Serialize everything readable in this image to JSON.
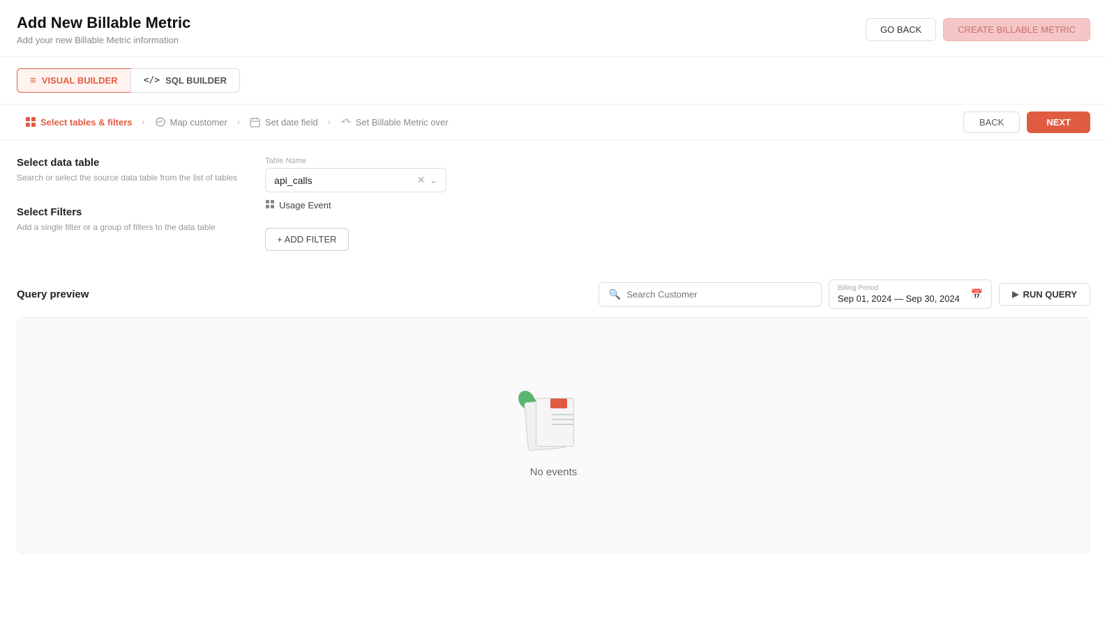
{
  "page": {
    "title": "Add New Billable Metric",
    "subtitle": "Add your new Billable Metric information"
  },
  "header_actions": {
    "go_back_label": "GO BACK",
    "create_label": "CREATE BILLABLE METRIC"
  },
  "builder_tabs": [
    {
      "id": "visual",
      "label": "VISUAL BUILDER",
      "active": true
    },
    {
      "id": "sql",
      "label": "SQL BUILDER",
      "active": false
    }
  ],
  "steps": [
    {
      "id": "tables",
      "label": "Select tables & filters",
      "active": true,
      "icon": "grid-icon"
    },
    {
      "id": "customer",
      "label": "Map customer",
      "active": false,
      "icon": "map-icon"
    },
    {
      "id": "date",
      "label": "Set date field",
      "active": false,
      "icon": "calendar-icon"
    },
    {
      "id": "metric",
      "label": "Set Billable Metric over",
      "active": false,
      "icon": "metric-icon"
    }
  ],
  "steps_nav": {
    "back_label": "BACK",
    "next_label": "NEXT"
  },
  "select_data_table": {
    "title": "Select data table",
    "description": "Search or select the source data table from the list of tables",
    "field_label": "Table Name",
    "selected_value": "api_calls",
    "badge_label": "Usage Event"
  },
  "select_filters": {
    "title": "Select Filters",
    "description": "Add a single filter or a group of filters to the data table",
    "add_button_label": "+ ADD FILTER"
  },
  "query_preview": {
    "title": "Query preview",
    "search_placeholder": "Search Customer",
    "billing_period_label": "Billing Period",
    "billing_period_value": "Sep 01, 2024 — Sep 30, 2024",
    "run_query_label": "RUN QUERY",
    "no_events_label": "No events"
  }
}
